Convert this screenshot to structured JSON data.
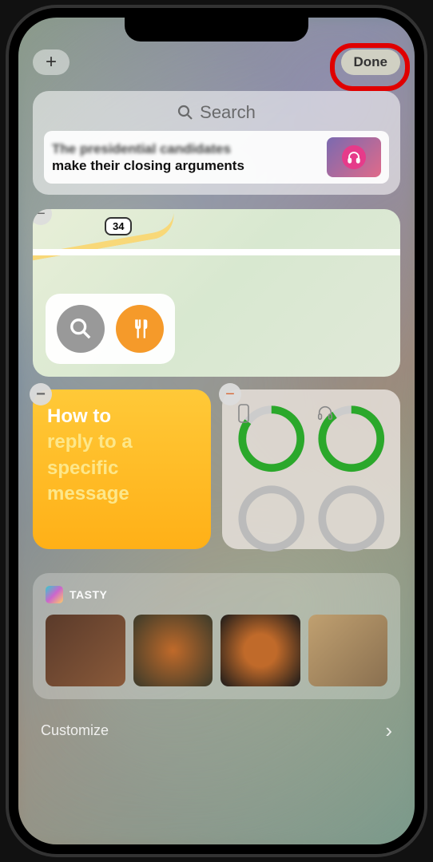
{
  "topbar": {
    "add_label": "+",
    "done_label": "Done"
  },
  "search": {
    "placeholder": "Search"
  },
  "news": {
    "title": "The presidential candidates",
    "subtitle": "make their closing arguments"
  },
  "map": {
    "road_label": "34"
  },
  "notes": {
    "line1": "How to",
    "line2": "reply to a specific message"
  },
  "tasty": {
    "label": "TASTY"
  },
  "customize": {
    "label": "Customize"
  },
  "icons": {
    "remove": "−",
    "chevron": "›"
  }
}
